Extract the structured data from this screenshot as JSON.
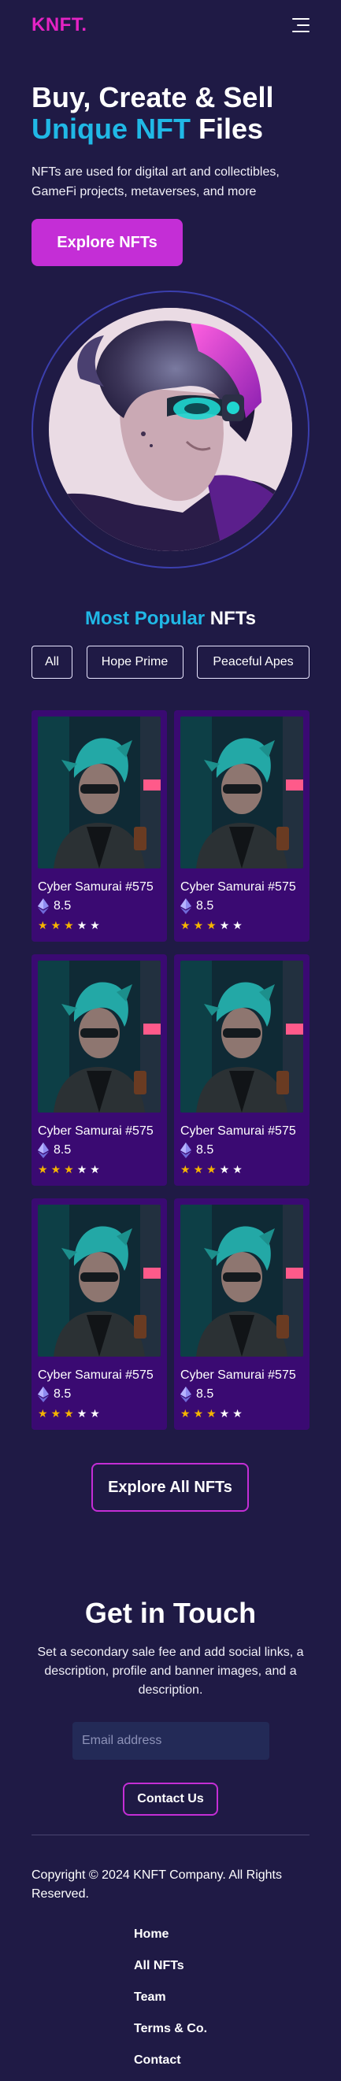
{
  "header": {
    "logo": "KNFT.",
    "menu_icon": "hamburger-menu-icon"
  },
  "hero": {
    "title_line1": "Buy, Create & Sell",
    "title_accent": "Unique NFT",
    "title_rest": " Files",
    "description": "NFTs are used for digital art and collectibles, GameFi projects, metaverses, and more",
    "cta_label": "Explore NFTs"
  },
  "popular": {
    "title_accent": "Most Popular",
    "title_rest": " NFTs",
    "filters": [
      "All",
      "Hope Prime",
      "Peaceful Apes"
    ]
  },
  "cards": [
    {
      "title": "Cyber Samurai #575",
      "price": "8.5",
      "rating": 3,
      "max_rating": 5
    },
    {
      "title": "Cyber Samurai #575",
      "price": "8.5",
      "rating": 3,
      "max_rating": 5
    },
    {
      "title": "Cyber Samurai #575",
      "price": "8.5",
      "rating": 3,
      "max_rating": 5
    },
    {
      "title": "Cyber Samurai #575",
      "price": "8.5",
      "rating": 3,
      "max_rating": 5
    },
    {
      "title": "Cyber Samurai #575",
      "price": "8.5",
      "rating": 3,
      "max_rating": 5
    },
    {
      "title": "Cyber Samurai #575",
      "price": "8.5",
      "rating": 3,
      "max_rating": 5
    }
  ],
  "explore_all_label": "Explore All NFTs",
  "contact": {
    "title": "Get in Touch",
    "text": "Set a secondary sale fee and add social links, a description, profile and banner images, and a description.",
    "email_placeholder": "Email address",
    "button_label": "Contact Us"
  },
  "footer": {
    "copyright": "Copyright © 2024 KNFT Company. All Rights Reserved.",
    "links": [
      "Home",
      "All NFTs",
      "Team",
      "Terms & Co.",
      "Contact"
    ]
  },
  "colors": {
    "background": "#1f1a45",
    "brand": "#e423c4",
    "accent": "#20b8e6",
    "card": "#3a0a72",
    "button": "#c42ed6"
  }
}
